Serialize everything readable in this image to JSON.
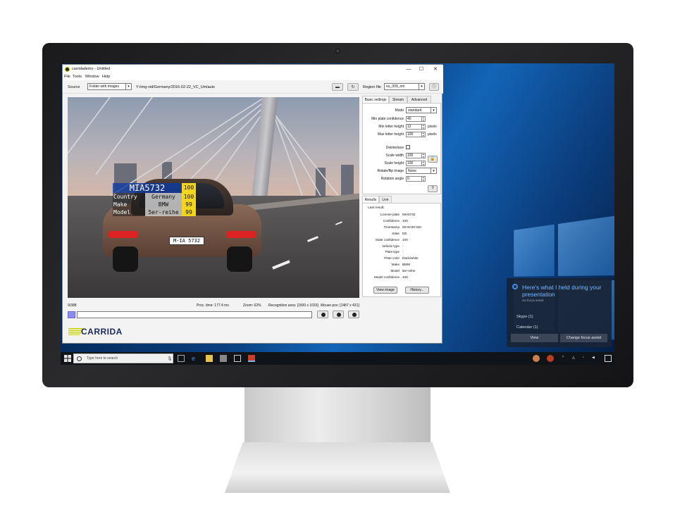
{
  "window": {
    "title": "carridademo - Untitled",
    "controls": {
      "minimize": "—",
      "maximize": "☐",
      "close": "✕"
    }
  },
  "menu": [
    "File",
    "Tools",
    "Window",
    "Help"
  ],
  "toolbar": {
    "source_label": "Source",
    "source_value": "Folder with images",
    "path": "Y:/img-vid/Germany/2016-02-22_VC_Umlauts",
    "region_label": "Region file",
    "region_value": "eu_009_nm"
  },
  "overlay": {
    "plate": "MIA5732",
    "plate_conf": "100",
    "rows": [
      {
        "key": "Country",
        "value": "Germany",
        "conf": "100"
      },
      {
        "key": "Make",
        "value": "BMW",
        "conf": "99"
      },
      {
        "key": "Model",
        "value": "5er-reihe",
        "conf": "99"
      }
    ],
    "car_plate": "M·IA 5732"
  },
  "status": {
    "frame": "9/388",
    "proc_time": "Proc. time: 177.4 ms",
    "zoom": "Zoom: 62%",
    "recognition_area": "Recognition area: [1500 x 1033]",
    "mouse_pos": "Mouse pos: [1487 x 431]",
    "progress_fraction": 0.03
  },
  "logo": {
    "text": "CARRIDA",
    "color": "#1c2a5e",
    "accent": "#c8d400"
  },
  "settings_tabs": [
    "Basic settings",
    "Stream",
    "Advanced"
  ],
  "settings": {
    "mode_label": "Mode",
    "mode_value": "standard",
    "min_plate_conf_label": "Min plate confidence",
    "min_plate_conf_value": "40",
    "min_letter_height_label": "Min letter height",
    "min_letter_height_value": "12",
    "max_letter_height_label": "Max letter height",
    "max_letter_height_value": "100",
    "pixels_unit": "pixels",
    "deinterlace_label": "Deinterlace",
    "scale_width_label": "Scale width",
    "scale_width_value": "100",
    "scale_height_label": "Scale height",
    "scale_height_value": "100",
    "rotate_label": "Rotate/flip image",
    "rotate_value": "None",
    "rotation_angle_label": "Rotation angle",
    "rotation_angle_value": "0"
  },
  "result_tabs": [
    "Results",
    "Live"
  ],
  "results": {
    "header": "Last result:",
    "rows": [
      {
        "key": "License plate",
        "value": "MIA5732"
      },
      {
        "key": "Confidence",
        "value": "100"
      },
      {
        "key": "Timestamp",
        "value": "00:00:00:320"
      },
      {
        "key": "State",
        "value": "DE"
      },
      {
        "key": "State confidence",
        "value": "100"
      },
      {
        "key": "Vehicle type",
        "value": "-"
      },
      {
        "key": "Plate type",
        "value": "-"
      },
      {
        "key": "Plate color",
        "value": "black/white"
      },
      {
        "key": "Make",
        "value": "BMW"
      },
      {
        "key": "Model",
        "value": "5er-reihe"
      },
      {
        "key": "Model confidence",
        "value": "100"
      }
    ],
    "view_image": "View image",
    "history": "History..."
  },
  "taskbar": {
    "search_placeholder": "Type here to search"
  },
  "focus_assist": {
    "title": "Here's what I held during your presentation",
    "subtitle": "via focus assist",
    "items": [
      "Skype (1)",
      "Calendar (1)"
    ],
    "view": "View",
    "change": "Change focus assist"
  }
}
